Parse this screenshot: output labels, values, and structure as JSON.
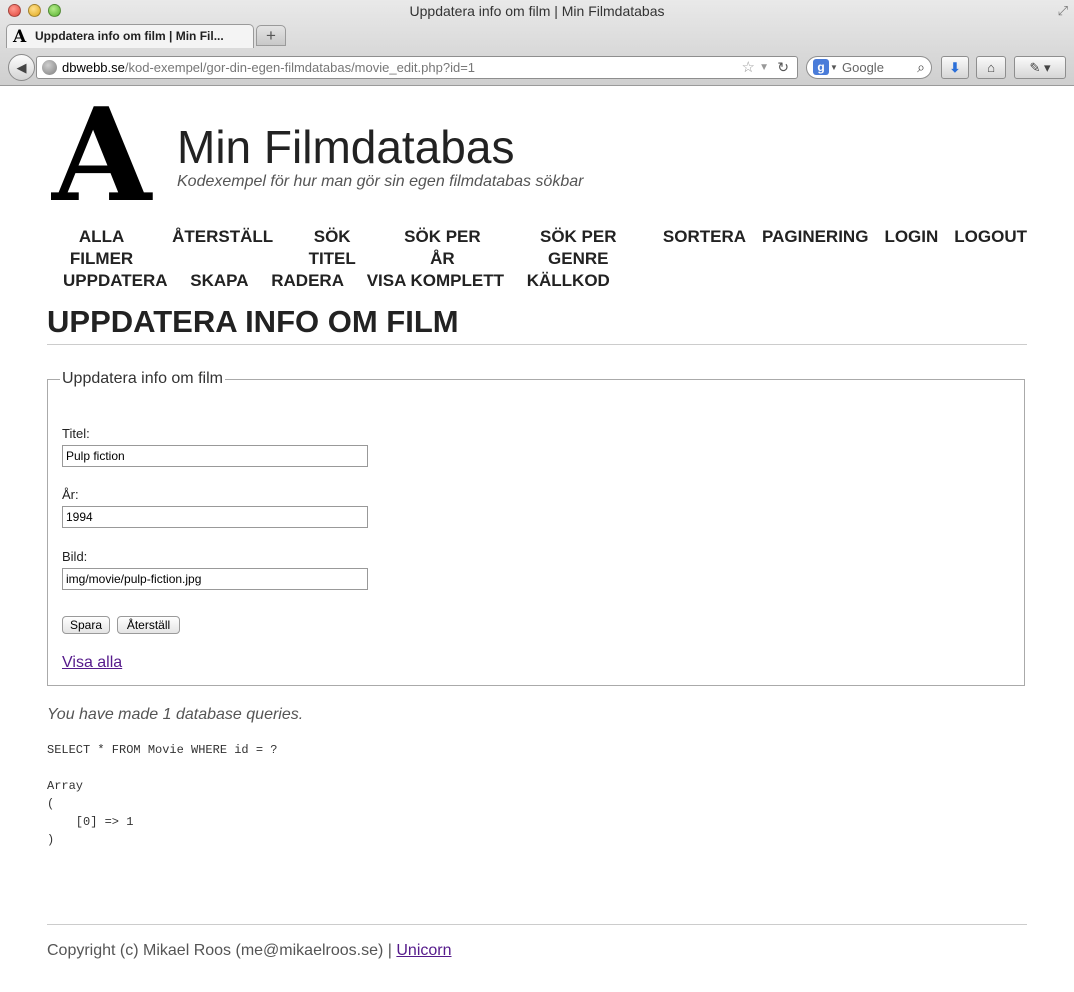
{
  "window": {
    "title": "Uppdatera info om film | Min Filmdatabas"
  },
  "tabs": [
    {
      "label": "Uppdatera info om film | Min Fil..."
    }
  ],
  "navbar": {
    "url_host": "dbwebb.se",
    "url_path": "/kod-exempel/gor-din-egen-filmdatabas/movie_edit.php?id=1",
    "search_placeholder": "Google"
  },
  "site": {
    "logo_letter": "A",
    "title": "Min Filmdatabas",
    "slogan": "Kodexempel för hur man gör sin egen filmdatabas sökbar"
  },
  "menu": {
    "row1": [
      "ALLA FILMER",
      "ÅTERSTÄLL",
      "SÖK TITEL",
      "SÖK PER ÅR",
      "SÖK PER GENRE",
      "SORTERA",
      "PAGINERING",
      "LOGIN",
      "LOGOUT"
    ],
    "row2": [
      "UPPDATERA",
      "SKAPA",
      "RADERA",
      "VISA KOMPLETT",
      "KÄLLKOD"
    ]
  },
  "main": {
    "page_title": "UPPDATERA INFO OM FILM",
    "form": {
      "legend": "Uppdatera info om film",
      "fields": [
        {
          "label": "Titel:",
          "value": "Pulp fiction"
        },
        {
          "label": "År:",
          "value": "1994"
        },
        {
          "label": "Bild:",
          "value": "img/movie/pulp-fiction.jpg"
        }
      ],
      "save_label": "Spara",
      "reset_label": "Återställ",
      "view_all_label": "Visa alla"
    },
    "query_count": "You have made 1 database queries.",
    "query_dump": "SELECT * FROM Movie WHERE id = ?\n\nArray\n(\n    [0] => 1\n)"
  },
  "footer": {
    "copyright": "Copyright (c) Mikael Roos (me@mikaelroos.se) | ",
    "link_label": "Unicorn"
  },
  "colors": {
    "link_visited": "#551a8b",
    "text": "#333333",
    "rule": "#cccccc"
  }
}
